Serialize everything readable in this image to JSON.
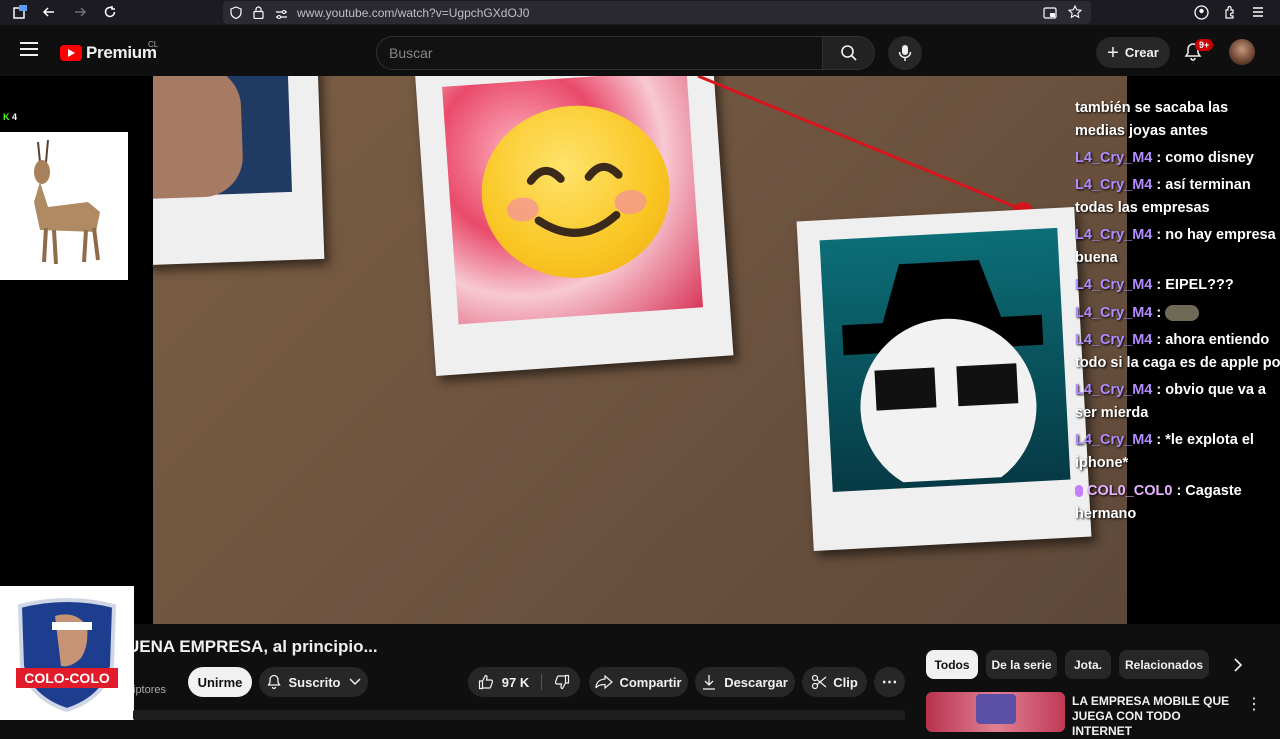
{
  "browser": {
    "url": "www.youtube.com/watch?v=UgpchGXdOJ0"
  },
  "header": {
    "brand": "Premium",
    "country": "CL",
    "search_placeholder": "Buscar",
    "create_label": "Crear",
    "notifications_badge": "9+"
  },
  "streamer_overlay": {
    "viewer_count": "4"
  },
  "chat": {
    "messages": [
      {
        "user": "",
        "text": "también se sacaba las"
      },
      {
        "user": "",
        "text": "medias joyas antes"
      },
      {
        "user": "L4_Cry_M4",
        "text": ": como disney"
      },
      {
        "user": "L4_Cry_M4",
        "text": ": así terminan"
      },
      {
        "user": "",
        "text": "todas las empresas"
      },
      {
        "user": "L4_Cry_M4",
        "text": ": no hay empresa"
      },
      {
        "user": "",
        "text": "buena"
      },
      {
        "user": "L4_Cry_M4",
        "text": ": EIPEL???"
      },
      {
        "user": "L4_Cry_M4",
        "text": ":"
      },
      {
        "user": "L4_Cry_M4",
        "text": ": ahora entiendo"
      },
      {
        "user": "",
        "text": "todo si la caga es de apple po"
      },
      {
        "user": "L4_Cry_M4",
        "text": ": obvio que va a"
      },
      {
        "user": "",
        "text": "ser mierda"
      },
      {
        "user": "L4_Cry_M4",
        "text": ": *le explota el"
      },
      {
        "user": "",
        "text": "iphone*"
      },
      {
        "user": "COL0_COL0",
        "text": ": Cagaste"
      },
      {
        "user": "",
        "text": "hermano"
      }
    ]
  },
  "badge_text": "COLO-COLO",
  "video": {
    "title": "UENA EMPRESA, al principio...",
    "channel_partial": "iptores"
  },
  "actions": {
    "join": "Unirme",
    "subscribed": "Suscrito",
    "likes": "97 K",
    "share": "Compartir",
    "download": "Descargar",
    "clip": "Clip"
  },
  "chips": [
    "Todos",
    "De la serie",
    "Jota.",
    "Relacionados"
  ],
  "related": {
    "title": "LA EMPRESA MOBILE QUE JUEGA CON TODO INTERNET"
  }
}
